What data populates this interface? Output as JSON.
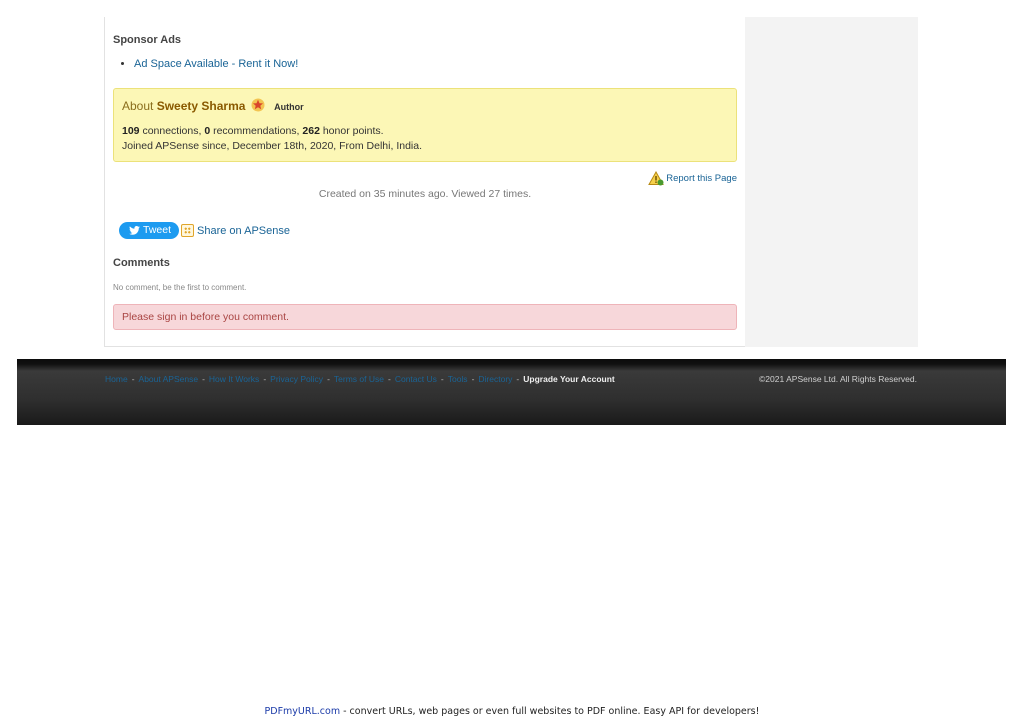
{
  "sponsor": {
    "title": "Sponsor Ads",
    "ad_link": "Ad Space Available - Rent it Now!"
  },
  "about": {
    "prefix": "About",
    "name": "Sweety Sharma",
    "role": "Author",
    "connections": "109",
    "connections_label": " connections, ",
    "recommendations": "0",
    "recommendations_label": " recommendations, ",
    "honor": "262",
    "honor_label": " honor points.",
    "joined": "Joined APSense since, December 18th, 2020, From Delhi, India."
  },
  "report": {
    "label": "Report this Page"
  },
  "meta": {
    "created": "Created on 35 minutes ago. Viewed 27 times."
  },
  "share": {
    "tweet_label": "Tweet",
    "apsense_label": "Share on APSense"
  },
  "comments": {
    "title": "Comments",
    "empty": "No comment, be the first to comment.",
    "signin": "Please sign in before you comment."
  },
  "footer": {
    "links": [
      "Home",
      "About APSense",
      "How It Works",
      "Privacy Policy",
      "Terms of Use",
      "Contact Us",
      "Tools",
      "Directory"
    ],
    "upgrade": "Upgrade Your Account",
    "separator": "-",
    "copyright": "©2021 APSense Ltd. All Rights Reserved."
  },
  "pdf_banner": {
    "brand": "PDFmyURL.com",
    "text": " - convert URLs, web pages or even full websites to PDF online. Easy API for developers!"
  }
}
